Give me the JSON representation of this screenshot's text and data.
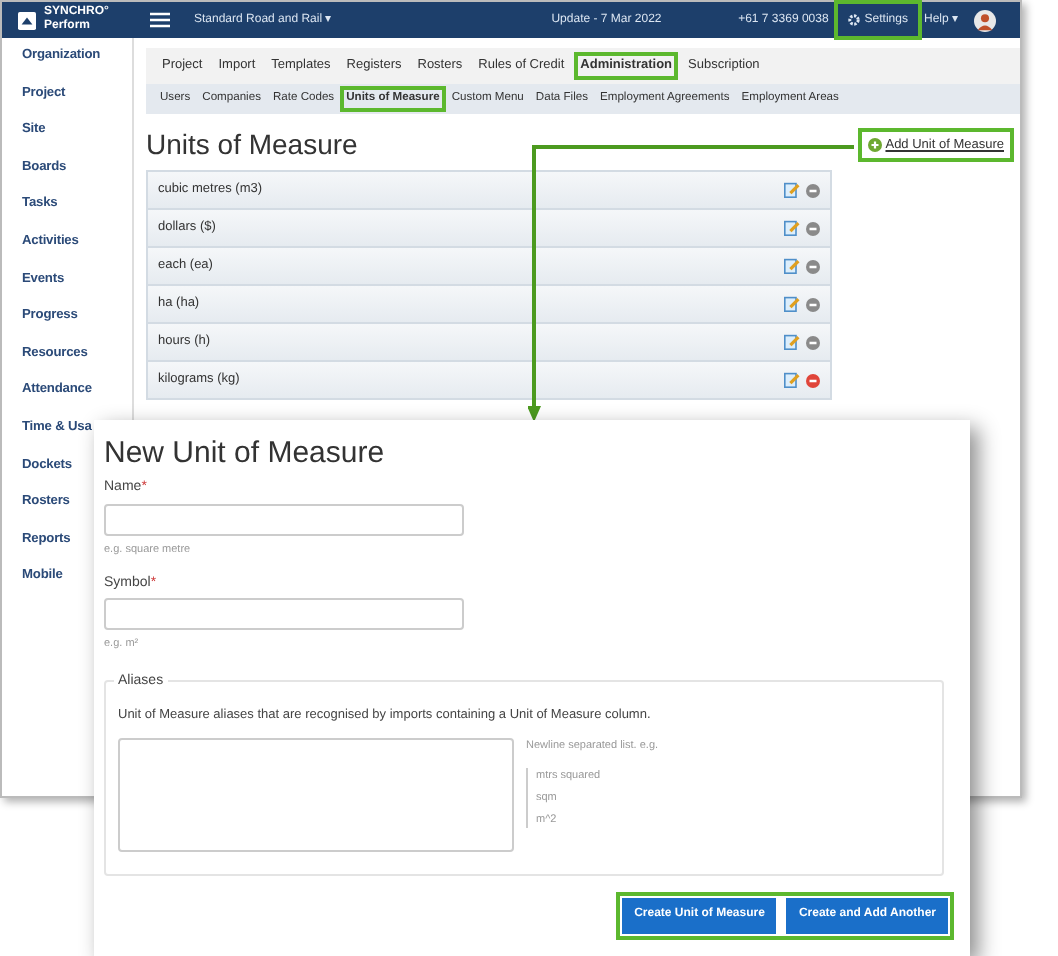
{
  "top_bar": {
    "logo_line_1": "SYNCHRO°",
    "logo_line_2": "Perform",
    "project": "Standard Road and Rail",
    "project_caret": "▾",
    "update": "Update - 7 Mar 2022",
    "phone": "+61 7 3369 0038",
    "settings": {
      "label": "Settings",
      "highlighted": true
    },
    "help": "Help",
    "help_caret": "▾"
  },
  "sidebar": {
    "items": [
      "Organization",
      "Project",
      "Site",
      "Boards",
      "Tasks",
      "Activities",
      "Events",
      "Progress",
      "Resources",
      "Attendance",
      "Time & Usa",
      "Dockets",
      "Rosters",
      "Reports",
      "Mobile"
    ]
  },
  "tabs": [
    {
      "label": "Project",
      "selected": false,
      "highlighted": false
    },
    {
      "label": "Import",
      "selected": false,
      "highlighted": false
    },
    {
      "label": "Templates",
      "selected": false,
      "highlighted": false
    },
    {
      "label": "Registers",
      "selected": false,
      "highlighted": false
    },
    {
      "label": "Rosters",
      "selected": false,
      "highlighted": false
    },
    {
      "label": "Rules of Credit",
      "selected": false,
      "highlighted": false
    },
    {
      "label": "Administration",
      "selected": true,
      "highlighted": true
    },
    {
      "label": "Subscription",
      "selected": false,
      "highlighted": false
    }
  ],
  "subtabs": [
    {
      "label": "Users",
      "selected": false,
      "highlighted": false
    },
    {
      "label": "Companies",
      "selected": false,
      "highlighted": false
    },
    {
      "label": "Rate Codes",
      "selected": false,
      "highlighted": false
    },
    {
      "label": "Units of Measure",
      "selected": true,
      "highlighted": true
    },
    {
      "label": "Custom Menu",
      "selected": false,
      "highlighted": false
    },
    {
      "label": "Data Files",
      "selected": false,
      "highlighted": false
    },
    {
      "label": "Employment Agreements",
      "selected": false,
      "highlighted": false
    },
    {
      "label": "Employment Areas",
      "selected": false,
      "highlighted": false
    }
  ],
  "page_title": "Units of Measure",
  "add_link": {
    "label": "Add Unit of Measure",
    "highlighted": true
  },
  "units": [
    {
      "name": "cubic metres (m3)",
      "delete_active": false
    },
    {
      "name": "dollars ($)",
      "delete_active": false
    },
    {
      "name": "each (ea)",
      "delete_active": false
    },
    {
      "name": "ha (ha)",
      "delete_active": false
    },
    {
      "name": "hours (h)",
      "delete_active": false
    },
    {
      "name": "kilograms (kg)",
      "delete_active": true
    }
  ],
  "dialog": {
    "title": "New Unit of Measure",
    "fields": [
      {
        "label": "Name",
        "required": "*",
        "hint": "e.g. square metre"
      },
      {
        "label": "Symbol",
        "required": "*",
        "hint": "e.g. m²"
      }
    ],
    "aliases": {
      "legend": "Aliases",
      "description": "Unit of Measure aliases that are recognised by imports containing a Unit of Measure column.",
      "hint": "Newline separated list. e.g.",
      "examples": [
        "mtrs squared",
        "sqm",
        "m^2"
      ]
    },
    "buttons_highlighted": true,
    "buttons": [
      "Create Unit of Measure",
      "Create and Add Another"
    ]
  }
}
